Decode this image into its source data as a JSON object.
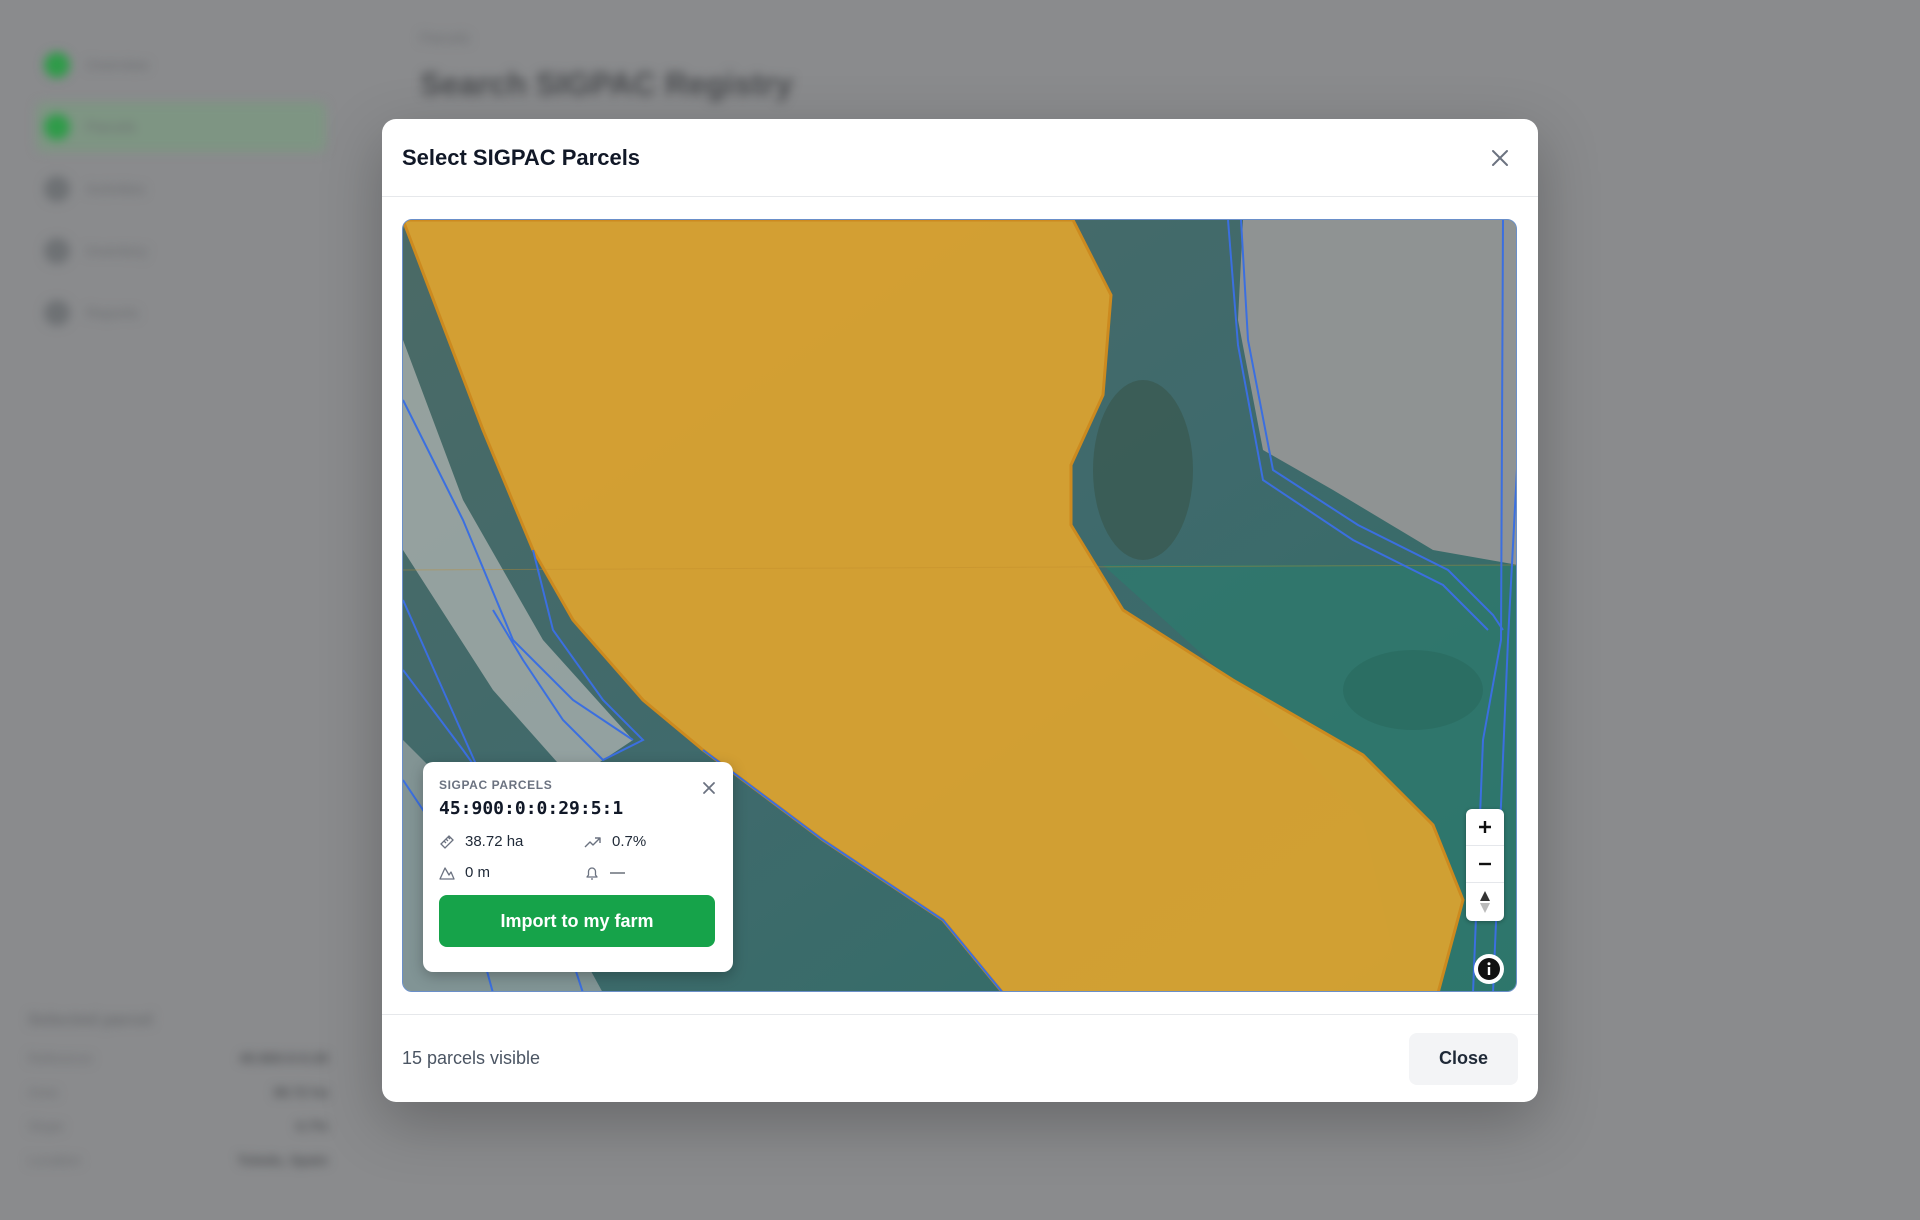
{
  "background": {
    "nav_items": [
      {
        "label": "Overview"
      },
      {
        "label": "Parcels"
      },
      {
        "label": "Activities"
      },
      {
        "label": "Inventory"
      },
      {
        "label": "Reports"
      }
    ],
    "breadcrumb": "Parcels",
    "page_title": "Search SIGPAC Registry",
    "panel_title": "Selected parcel",
    "panel_rows": [
      {
        "key": "Reference",
        "value": "45:900:0:0:29"
      },
      {
        "key": "Area",
        "value": "38.72 ha"
      },
      {
        "key": "Slope",
        "value": "0.7%"
      },
      {
        "key": "Location",
        "value": "Toledo, Spain"
      }
    ]
  },
  "modal": {
    "title": "Select SIGPAC Parcels",
    "close_icon": "close-icon"
  },
  "popup": {
    "label": "SIGPAC PARCELS",
    "parcel_id": "45:900:0:0:29:5:1",
    "area": "38.72 ha",
    "slope": "0.7%",
    "altitude": "0 m",
    "irrigation": "—",
    "import_button": "Import to my farm"
  },
  "map_controls": {
    "zoom_in": "+",
    "zoom_out": "−",
    "compass_icon": "compass-icon",
    "info_icon": "info-icon"
  },
  "footer": {
    "status": "15 parcels visible",
    "close_button": "Close"
  },
  "colors": {
    "selected_parcel": "#e2a52d",
    "parcel_outline": "#3b6fe0",
    "primary_button": "#16a34a"
  }
}
